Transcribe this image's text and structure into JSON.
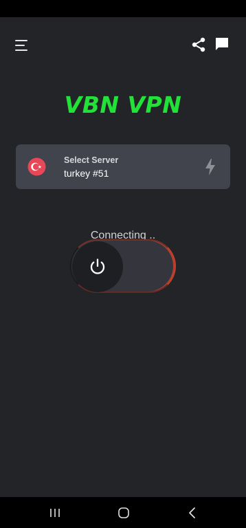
{
  "app": {
    "title": "VBN VPN",
    "accent_color": "#22e23a",
    "background_color": "#232427"
  },
  "header": {
    "menu_icon": "hamburger-menu-icon",
    "share_icon": "share-icon",
    "chat_icon": "chat-bubble-icon"
  },
  "server": {
    "caption": "Select Server",
    "name": "turkey #51",
    "flag_icon": "turkey-flag-icon",
    "speed_icon": "lightning-bolt-icon"
  },
  "connection": {
    "status": "Connecting ..",
    "power_icon": "power-icon",
    "ring_color": "#c4422f"
  },
  "system_nav": {
    "recent_icon": "recent-apps-icon",
    "home_icon": "home-icon",
    "back_icon": "back-icon"
  }
}
